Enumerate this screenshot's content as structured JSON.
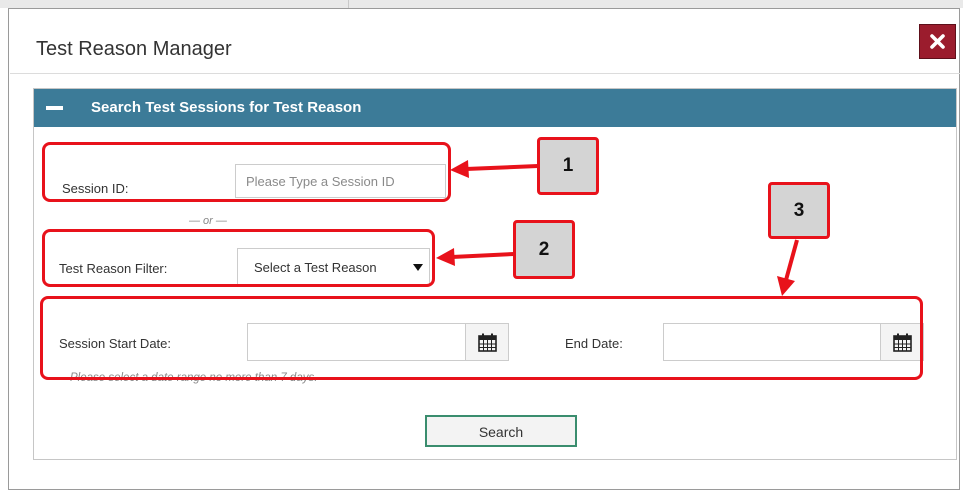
{
  "dialog": {
    "title": "Test Reason Manager",
    "close_icon": "close-x-icon",
    "close_color": "#9b1c2d"
  },
  "panel": {
    "title": "Search Test Sessions for Test Reason",
    "collapse_icon": "minus-icon",
    "header_color": "#3c7b98"
  },
  "form": {
    "session_id_label": "Session ID:",
    "session_id_value": "",
    "session_id_placeholder": "Please Type a Session ID",
    "or_text": "— or —",
    "test_reason_label": "Test Reason Filter:",
    "test_reason_selected": "Select a Test Reason",
    "start_date_label": "Session Start Date:",
    "start_date_value": "",
    "end_date_label": "End Date:",
    "end_date_value": "",
    "calendar_icon": "calendar-icon",
    "date_hint": "Please select a date range no more than 7 days.",
    "search_label": "Search"
  },
  "annotations": {
    "color": "#e8121b",
    "badges": [
      "1",
      "2",
      "3"
    ]
  }
}
